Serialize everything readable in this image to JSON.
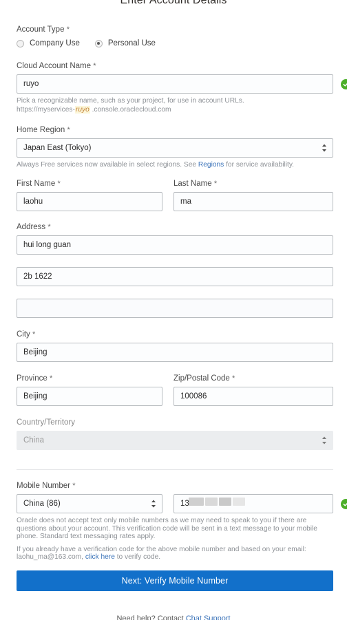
{
  "page": {
    "title": "Enter Account Details",
    "footer_prefix": "Need help? Contact ",
    "footer_link": "Chat Support"
  },
  "colors": {
    "accent": "#1270ca",
    "link": "#3b73b9",
    "valid_green": "#4caf28",
    "highlight_bg": "#fcf6d9",
    "highlight_text": "#c07e32"
  },
  "account_type": {
    "label": "Account Type",
    "required": "*",
    "options": [
      {
        "label": "Company Use",
        "selected": false
      },
      {
        "label": "Personal Use",
        "selected": true
      }
    ]
  },
  "cloud_account_name": {
    "label": "Cloud Account Name",
    "required": "*",
    "value": "ruyo",
    "valid": true,
    "hint_line1": "Pick a recognizable name, such as your project, for use in account URLs.",
    "hint_url_prefix": "https://myservices-",
    "hint_url_highlight": "ruyo",
    "hint_url_suffix": ".console.oraclecloud.com"
  },
  "home_region": {
    "label": "Home Region",
    "required": "*",
    "value": "Japan East (Tokyo)",
    "hint_before": "Always Free services now available in select regions. See ",
    "hint_link": "Regions",
    "hint_after": " for service availability."
  },
  "first_name": {
    "label": "First Name",
    "required": "*",
    "value": "laohu"
  },
  "last_name": {
    "label": "Last Name",
    "required": "*",
    "value": "ma"
  },
  "address": {
    "label": "Address",
    "required": "*",
    "line1": "hui long guan",
    "line2": "2b 1622",
    "line3": "",
    "line3_placeholder": ""
  },
  "city": {
    "label": "City",
    "required": "*",
    "value": "Beijing"
  },
  "province": {
    "label": "Province",
    "required": "*",
    "value": "Beijing"
  },
  "zip": {
    "label": "Zip/Postal Code",
    "required": "*",
    "value": "100086"
  },
  "country": {
    "label": "Country/Territory",
    "required": "",
    "value": "China",
    "disabled": true
  },
  "mobile": {
    "label": "Mobile Number",
    "required": "*",
    "country_code": "China (86)",
    "number_visible": "13",
    "valid": true,
    "note1": "Oracle does not accept text only mobile numbers as we may need to speak to you if there are questions about your account. This verification code will be sent in a text message to your mobile phone. Standard text messaging rates apply.",
    "note2_before": "If you already have a verification code for the above mobile number and based on your email: laohu_ma@163.com, ",
    "note2_link": "click here",
    "note2_after": " to verify code."
  },
  "submit": {
    "label": "Next: Verify Mobile Number"
  },
  "icons": {
    "valid_check": "check-circle-icon",
    "select_chevron": "chevron-updown-icon"
  }
}
